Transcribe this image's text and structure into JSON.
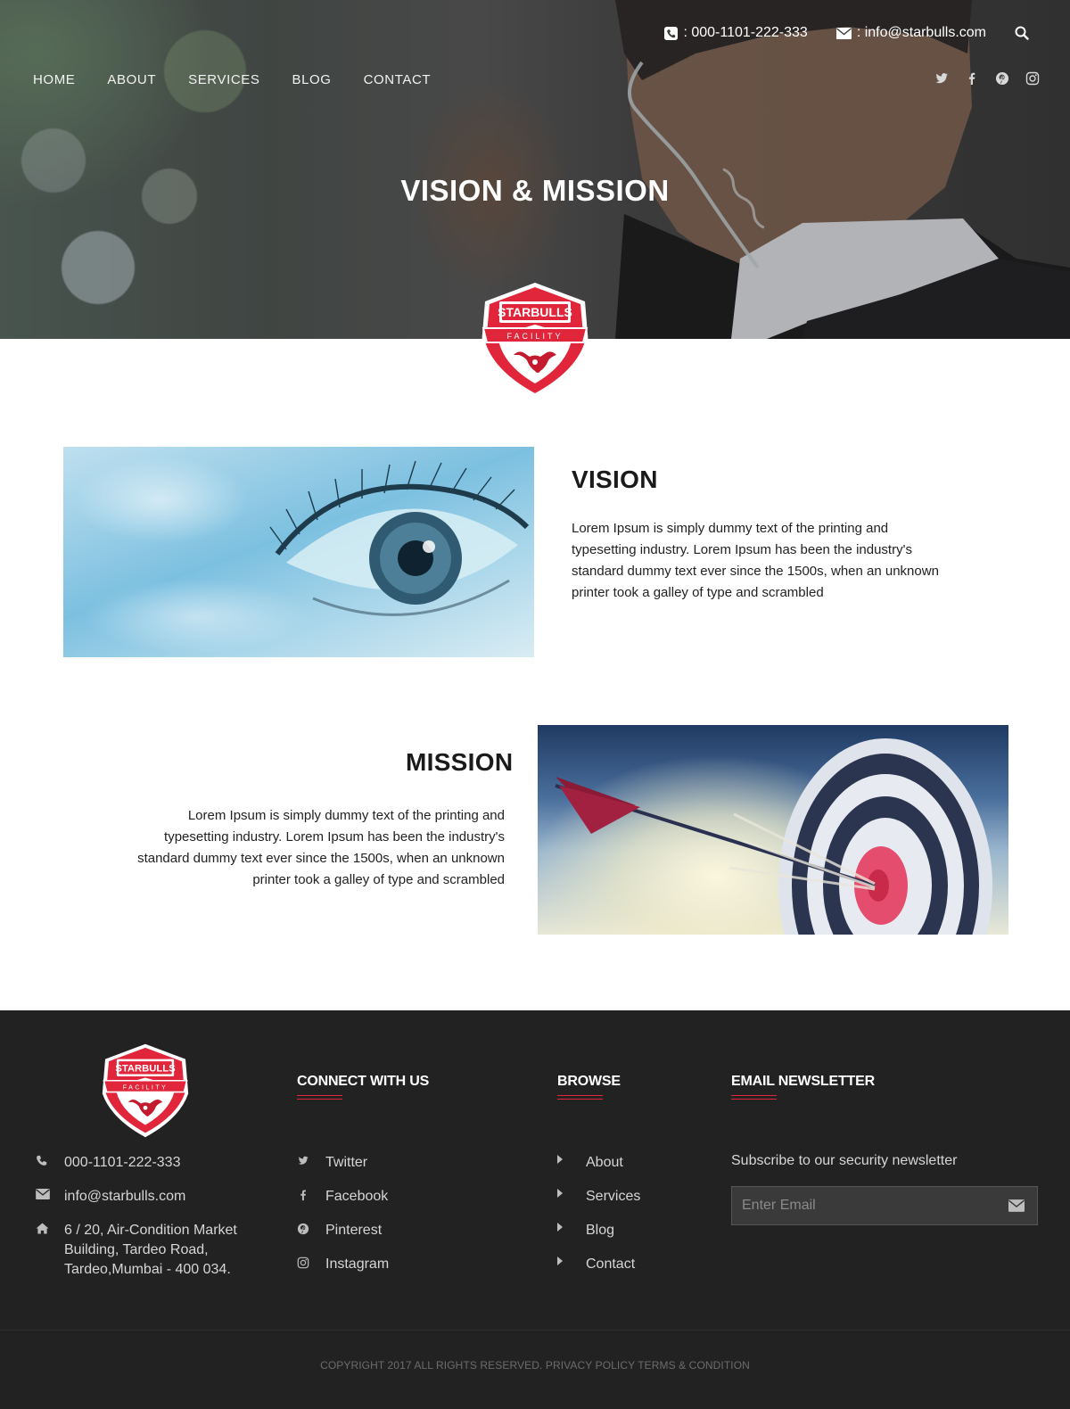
{
  "header": {
    "phone": ": 000-1101-222-333",
    "email": ": info@starbulls.com",
    "nav": [
      "HOME",
      "ABOUT",
      "SERVICES",
      "BLOG",
      "CONTACT"
    ],
    "social_icons": [
      "twitter-icon",
      "facebook-icon",
      "pinterest-icon",
      "instagram-icon"
    ]
  },
  "hero": {
    "title": "VISION & MISSION"
  },
  "logo": {
    "text_top": "STARBULLS",
    "text_bottom": "FACILITY"
  },
  "vision": {
    "title": "VISION",
    "text": "Lorem Ipsum is simply dummy text of the printing and typesetting industry. Lorem Ipsum has been the industry's standard dummy text ever since the 1500s, when an unknown printer took a galley of type and scrambled"
  },
  "mission": {
    "title": "MISSION",
    "text": "Lorem Ipsum is simply dummy text of the printing and typesetting industry. Lorem Ipsum has been the industry's standard dummy text ever since the 1500s, when an unknown printer took a galley of type and scrambled"
  },
  "footer": {
    "contact": {
      "phone": "000-1101-222-333",
      "email": "info@starbulls.com",
      "address": "6 / 20, Air-Condition Market Building, Tardeo Road, Tardeo,Mumbai - 400 034."
    },
    "connect": {
      "title": "CONNECT WITH US",
      "items": [
        "Twitter",
        "Facebook",
        "Pinterest",
        "Instagram"
      ]
    },
    "browse": {
      "title": "BROWSE",
      "items": [
        "About",
        "Services",
        "Blog",
        "Contact"
      ]
    },
    "newsletter": {
      "title": "EMAIL NEWSLETTER",
      "text": "Subscribe to our security newsletter",
      "placeholder": "Enter Email"
    },
    "copyright": "COPYRIGHT 2017 ALL RIGHTS RESERVED. PRIVACY POLICY TERMS & CONDITION"
  },
  "colors": {
    "accent": "#e0263a",
    "footer_bg": "#222222",
    "logo_red": "#e1263b"
  }
}
